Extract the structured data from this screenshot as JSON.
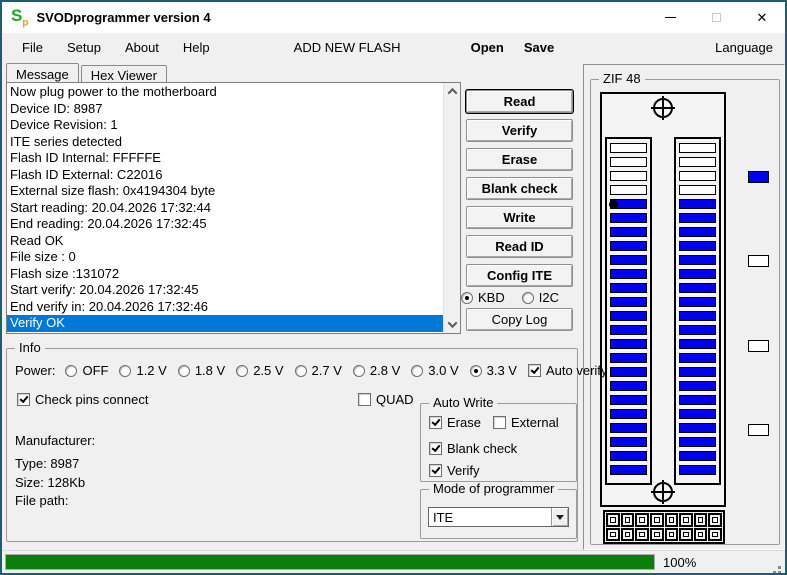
{
  "window": {
    "title": "SVODprogrammer version 4",
    "icon_main": "S",
    "icon_sub": "p"
  },
  "menu": {
    "items": [
      "File",
      "Setup",
      "About",
      "Help"
    ],
    "flash": "ADD NEW FLASH",
    "open": "Open",
    "save": "Save",
    "language": "Language"
  },
  "tabs": [
    {
      "label": "Message",
      "active": true
    },
    {
      "label": "Hex Viewer",
      "active": false
    }
  ],
  "log": {
    "lines": [
      "Now plug power to the motherboard",
      "Device ID: 8987",
      "Device Revision: 1",
      "ITE series detected",
      "Flash ID Internal: FFFFFE",
      "Flash ID External: C22016",
      "External size flash: 0x4194304 byte",
      "Start reading: 20.04.2026 17:32:44",
      "End reading: 20.04.2026 17:32:45",
      "Read OK",
      "File size : 0",
      "Flash size :131072",
      "Start verify: 20.04.2026 17:32:45",
      "End verify in: 20.04.2026 17:32:46",
      "Verify OK"
    ],
    "selected_index": 14
  },
  "actions": {
    "buttons": [
      {
        "label": "Read",
        "default": true
      },
      {
        "label": "Verify"
      },
      {
        "label": "Erase"
      },
      {
        "label": "Blank check"
      },
      {
        "label": "Write"
      },
      {
        "label": "Read ID"
      },
      {
        "label": "Config ITE"
      }
    ],
    "bus_radios": [
      {
        "label": "KBD",
        "selected": true
      },
      {
        "label": "I2C",
        "selected": false
      }
    ],
    "copy_log_label": "Copy Log"
  },
  "zif": {
    "title": "ZIF 48",
    "slots_per_column": 24,
    "inactive_top_slots": 4,
    "pin1_marker": {
      "column": 0,
      "slot": 4
    },
    "indicators": [
      {
        "color": "#0000f0"
      },
      {
        "color": "#ffffff"
      },
      {
        "color": "#ffffff"
      },
      {
        "color": "#ffffff"
      }
    ],
    "header_connector": {
      "cols": 8,
      "rows": 2
    }
  },
  "info": {
    "title": "Info",
    "power_label": "Power:",
    "power_options": [
      {
        "label": "OFF"
      },
      {
        "label": "1.2 V"
      },
      {
        "label": "1.8 V"
      },
      {
        "label": "2.5 V"
      },
      {
        "label": "2.7 V"
      },
      {
        "label": "2.8 V"
      },
      {
        "label": "3.0 V"
      },
      {
        "label": "3.3 V",
        "selected": true
      }
    ],
    "auto_verify": {
      "label": "Auto verify",
      "checked": true
    },
    "check_pins": {
      "label": "Check pins connect",
      "checked": true
    },
    "quad": {
      "label": "QUAD",
      "checked": false
    },
    "fields": [
      {
        "label": "Manufacturer:"
      },
      {
        "label": "Type: 8987"
      },
      {
        "label": "Size: 128Kb"
      },
      {
        "label": "File path:"
      }
    ],
    "auto_write": {
      "title": "Auto Write",
      "options": [
        {
          "label": "Erase",
          "checked": true
        },
        {
          "label": "External",
          "checked": false
        },
        {
          "label": "Blank check",
          "checked": true
        },
        {
          "label": "Verify",
          "checked": true
        }
      ]
    },
    "mode": {
      "title": "Mode of programmer",
      "value": "ITE"
    }
  },
  "status": {
    "progress_percent": 100,
    "percent_label": "100%"
  },
  "colors": {
    "pin_active": "#0000f0",
    "selection": "#0078d7",
    "progress": "#0c7e0c",
    "window_border": "#17606e"
  }
}
